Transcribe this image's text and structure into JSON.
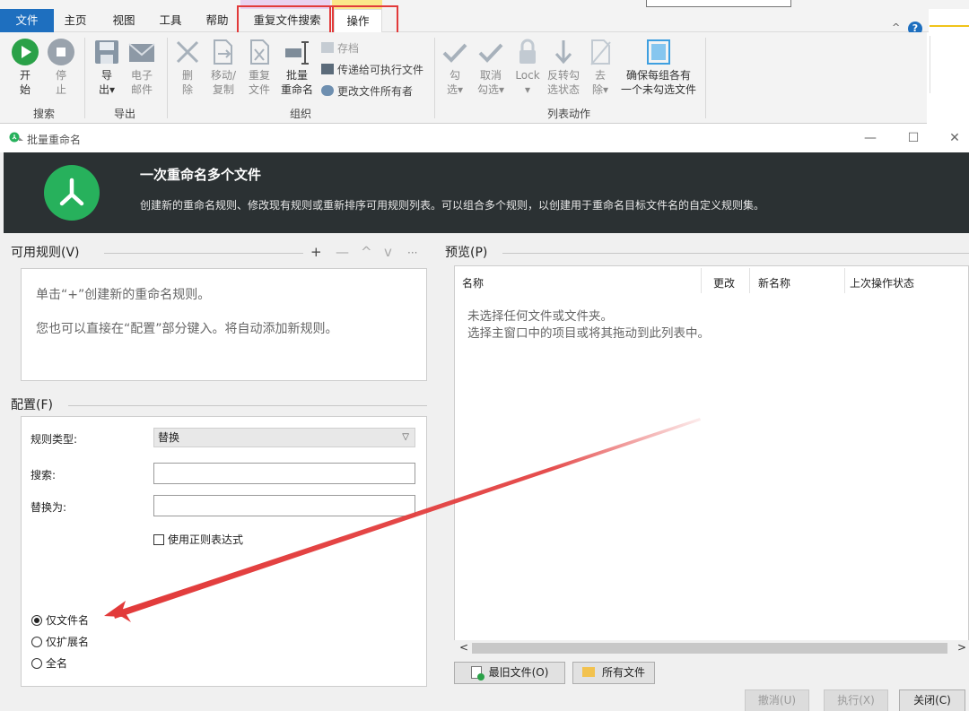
{
  "ribbon": {
    "tabs": [
      "文件",
      "主页",
      "视图",
      "工具",
      "帮助",
      "重复文件搜索",
      "操作"
    ],
    "help_glyph": "?",
    "chevron_glyph": "^",
    "buttons": {
      "start": [
        "开",
        "始"
      ],
      "stop": [
        "停",
        "止"
      ],
      "export": [
        "导",
        "出▾"
      ],
      "email": [
        "电子",
        "邮件"
      ],
      "delete": [
        "删",
        "除"
      ],
      "move_copy": [
        "移动/",
        "复制"
      ],
      "dup_files": [
        "重复",
        "文件"
      ],
      "batch_rename": [
        "批量",
        "重命名"
      ],
      "archive": "存档",
      "pass_exe": "传递给可执行文件",
      "change_owner": "更改文件所有者",
      "check": [
        "勾",
        "选▾"
      ],
      "uncheck": [
        "取消",
        "勾选▾"
      ],
      "lock": [
        "Lock",
        "▾"
      ],
      "invert": [
        "反转勾",
        "选状态"
      ],
      "remove": [
        "去",
        "除▾"
      ],
      "ensure": [
        "确保每组各有",
        "一个未勾选文件"
      ]
    },
    "groups": [
      "搜索",
      "导出",
      "组织",
      "列表动作"
    ]
  },
  "dialog": {
    "title": "批量重命名",
    "controls": {
      "min": "—",
      "max": "☐",
      "close": "✕"
    },
    "banner": {
      "heading": "一次重命名多个文件",
      "description": "创建新的重命名规则、修改现有规则或重新排序可用规则列表。可以组合多个规则，以创建用于重命名目标文件名的自定义规则集。"
    },
    "rules": {
      "title": "可用规则(V)",
      "toolbar": [
        "+",
        "—",
        "^",
        "v",
        "···"
      ],
      "hint1": "单击“+”创建新的重命名规则。",
      "hint2": "您也可以直接在“配置”部分键入。将自动添加新规则。"
    },
    "config": {
      "title": "配置(F)",
      "rule_type_label": "规则类型:",
      "rule_type_value": "替换",
      "search_label": "搜索:",
      "replace_label": "替换为:",
      "search_value": "",
      "replace_value": "",
      "regex_label": "使用正则表达式",
      "radios": [
        {
          "label": "仅文件名",
          "checked": true
        },
        {
          "label": "仅扩展名",
          "checked": false
        },
        {
          "label": "全名",
          "checked": false
        }
      ]
    },
    "preview": {
      "title": "预览(P)",
      "columns": [
        "名称",
        "更改",
        "新名称",
        "上次操作状态"
      ],
      "empty_line1": "未选择任何文件或文件夹。",
      "empty_line2": "选择主窗口中的项目或将其拖动到此列表中。",
      "scroll_left": "<",
      "scroll_right": ">"
    },
    "buttons": {
      "old_files": "最旧文件(O)",
      "all_files": "所有文件",
      "undo": "撤消(U)",
      "run": "执行(X)",
      "close": "关闭(C)"
    }
  },
  "colors": {
    "accent_blue": "#1e6fbf",
    "banner_bg": "#2b3133",
    "logo_green": "#27b15c",
    "highlight_red": "#e23a3a"
  }
}
